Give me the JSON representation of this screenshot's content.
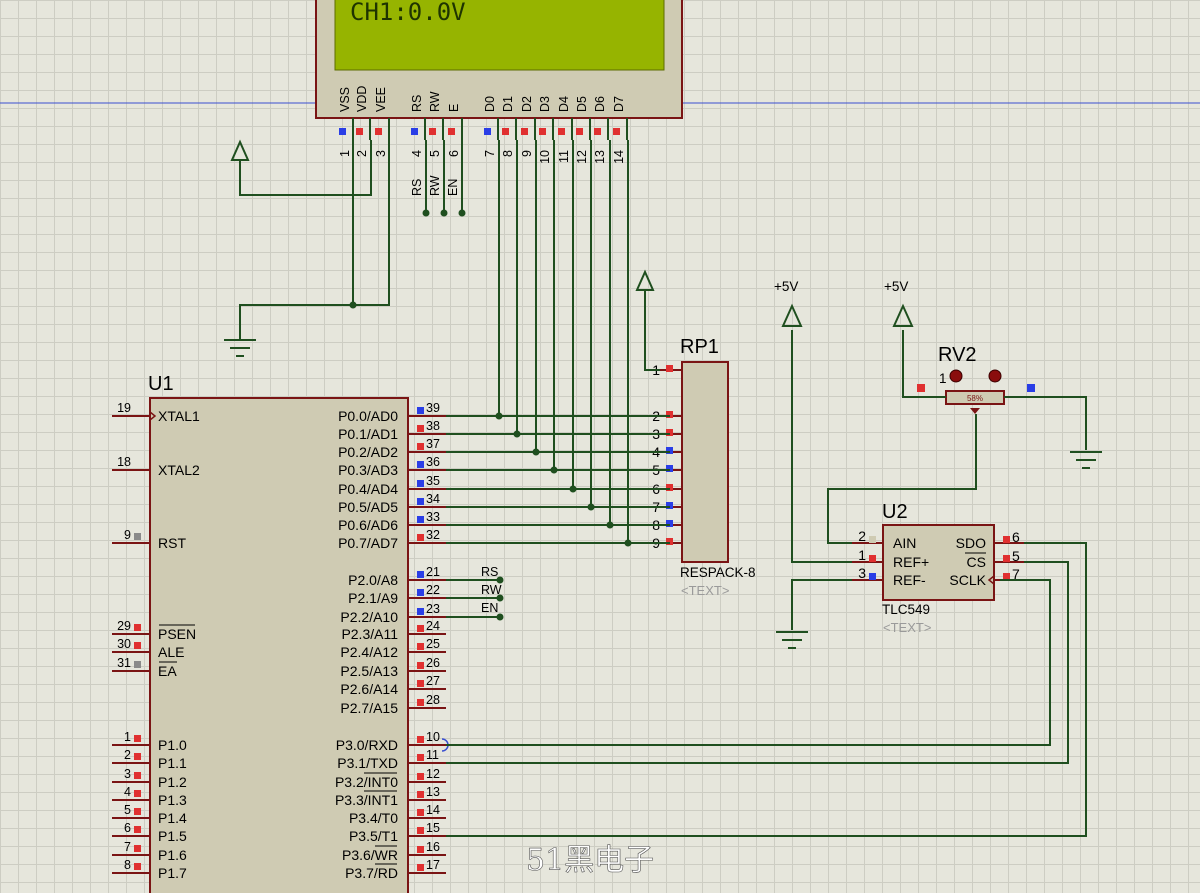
{
  "lcd": {
    "display_text": "CH1:0.0V",
    "pin_names": [
      "VSS",
      "VDD",
      "VEE",
      "RS",
      "RW",
      "E",
      "D0",
      "D1",
      "D2",
      "D3",
      "D4",
      "D5",
      "D6",
      "D7"
    ],
    "pin_numbers": [
      "1",
      "2",
      "3",
      "4",
      "5",
      "6",
      "7",
      "8",
      "9",
      "10",
      "11",
      "12",
      "13",
      "14"
    ],
    "net_labels": [
      "RS",
      "RW",
      "EN"
    ]
  },
  "u1": {
    "ref": "U1",
    "left_pins": [
      {
        "num": "19",
        "name": "XTAL1"
      },
      {
        "num": "18",
        "name": "XTAL2"
      },
      {
        "num": "9",
        "name": "RST"
      },
      {
        "num": "29",
        "name": "PSEN"
      },
      {
        "num": "30",
        "name": "ALE"
      },
      {
        "num": "31",
        "name": "EA"
      },
      {
        "num": "1",
        "name": "P1.0"
      },
      {
        "num": "2",
        "name": "P1.1"
      },
      {
        "num": "3",
        "name": "P1.2"
      },
      {
        "num": "4",
        "name": "P1.3"
      },
      {
        "num": "5",
        "name": "P1.4"
      },
      {
        "num": "6",
        "name": "P1.5"
      },
      {
        "num": "7",
        "name": "P1.6"
      },
      {
        "num": "8",
        "name": "P1.7"
      }
    ],
    "right_pins": [
      {
        "num": "39",
        "name": "P0.0/AD0"
      },
      {
        "num": "38",
        "name": "P0.1/AD1"
      },
      {
        "num": "37",
        "name": "P0.2/AD2"
      },
      {
        "num": "36",
        "name": "P0.3/AD3"
      },
      {
        "num": "35",
        "name": "P0.4/AD4"
      },
      {
        "num": "34",
        "name": "P0.5/AD5"
      },
      {
        "num": "33",
        "name": "P0.6/AD6"
      },
      {
        "num": "32",
        "name": "P0.7/AD7"
      },
      {
        "num": "21",
        "name": "P2.0/A8"
      },
      {
        "num": "22",
        "name": "P2.1/A9"
      },
      {
        "num": "23",
        "name": "P2.2/A10"
      },
      {
        "num": "24",
        "name": "P2.3/A11"
      },
      {
        "num": "25",
        "name": "P2.4/A12"
      },
      {
        "num": "26",
        "name": "P2.5/A13"
      },
      {
        "num": "27",
        "name": "P2.6/A14"
      },
      {
        "num": "28",
        "name": "P2.7/A15"
      },
      {
        "num": "10",
        "name": "P3.0/RXD"
      },
      {
        "num": "11",
        "name": "P3.1/TXD"
      },
      {
        "num": "12",
        "name": "P3.2/INT0"
      },
      {
        "num": "13",
        "name": "P3.3/INT1"
      },
      {
        "num": "14",
        "name": "P3.4/T0"
      },
      {
        "num": "15",
        "name": "P3.5/T1"
      },
      {
        "num": "16",
        "name": "P3.6/WR"
      },
      {
        "num": "17",
        "name": "P3.7/RD"
      }
    ],
    "p2_net_labels": [
      "RS",
      "RW",
      "EN"
    ]
  },
  "rp1": {
    "ref": "RP1",
    "part": "RESPACK-8",
    "text": "<TEXT>",
    "pin_numbers": [
      "1",
      "2",
      "3",
      "4",
      "5",
      "6",
      "7",
      "8",
      "9"
    ]
  },
  "rv2": {
    "ref": "RV2",
    "pin_label": "1",
    "percent": "58%"
  },
  "u2": {
    "ref": "U2",
    "part": "TLC549",
    "text": "<TEXT>",
    "left_pins": [
      {
        "num": "2",
        "name": "AIN"
      },
      {
        "num": "1",
        "name": "REF+"
      },
      {
        "num": "3",
        "name": "REF-"
      }
    ],
    "right_pins": [
      {
        "num": "6",
        "name": "SDO"
      },
      {
        "num": "5",
        "name": "CS"
      },
      {
        "num": "7",
        "name": "SCLK"
      }
    ]
  },
  "power_labels": [
    "+5V",
    "+5V"
  ],
  "watermark": "51黑电子",
  "colors": {
    "background": "#e6e6dc",
    "grid": "#cdcdc3",
    "wire": "#1f4f1f",
    "component_body": "#cfcbb3",
    "component_outline": "#7a1414",
    "lcd_screen": "#96b400",
    "pin_red": "#e03030",
    "pin_blue": "#2a3ee6"
  }
}
